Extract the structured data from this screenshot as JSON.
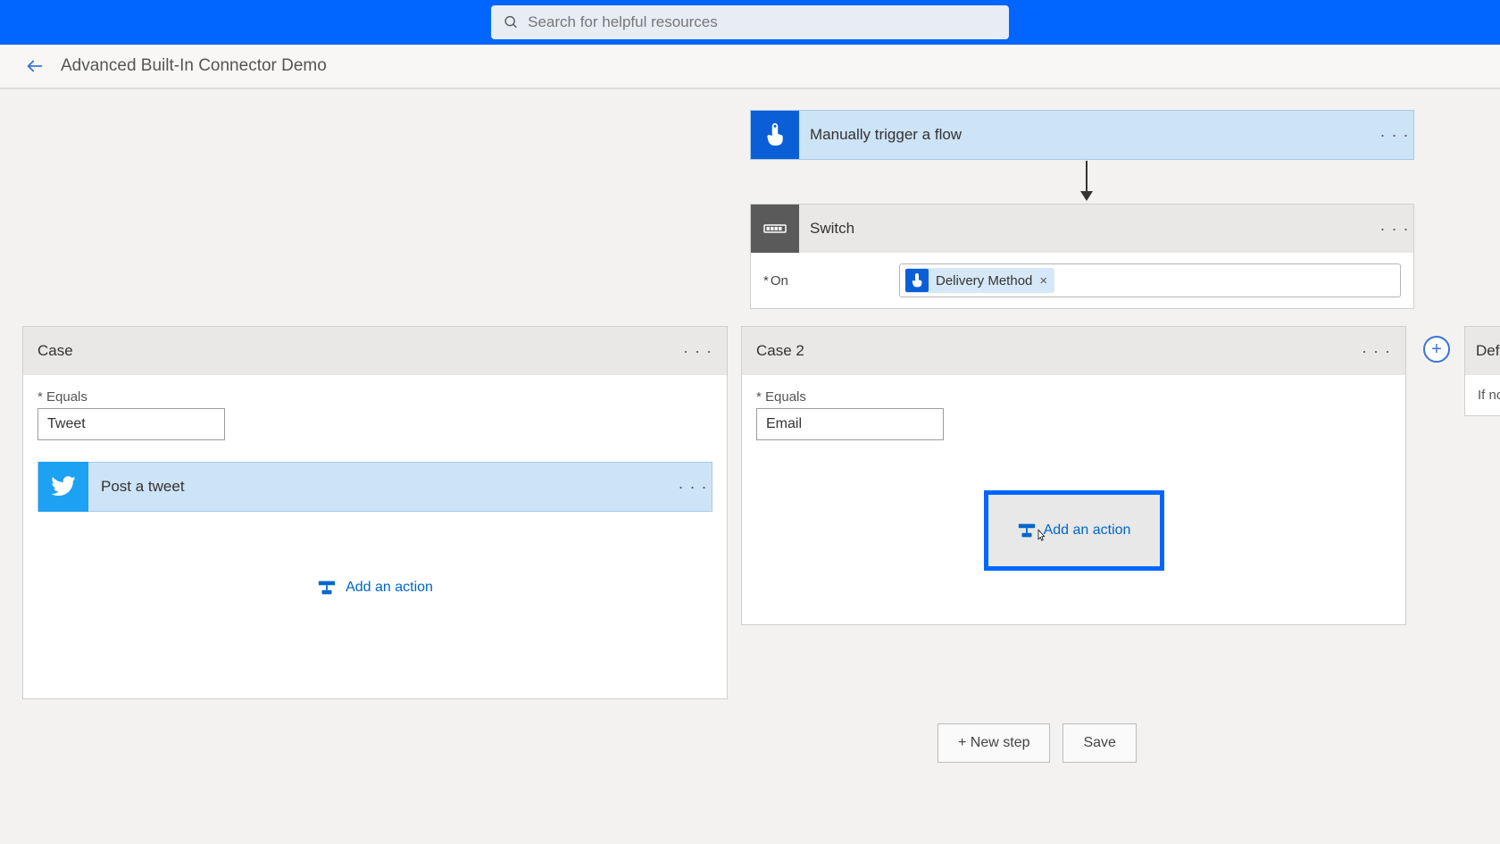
{
  "search": {
    "placeholder": "Search for helpful resources"
  },
  "page": {
    "title": "Advanced Built-In Connector Demo"
  },
  "trigger": {
    "label": "Manually trigger a flow"
  },
  "switch": {
    "label": "Switch",
    "on_label": "On",
    "token": "Delivery Method",
    "token_close": "×"
  },
  "case1": {
    "title": "Case",
    "equals_label": "Equals",
    "equals_value": "Tweet",
    "action_label": "Post a tweet",
    "add_action": "Add an action"
  },
  "case2": {
    "title": "Case 2",
    "equals_label": "Equals",
    "equals_value": "Email",
    "add_action": "Add an action"
  },
  "default_card": {
    "title": "Defa",
    "body": "If no"
  },
  "footer": {
    "new_step": "+ New step",
    "save": "Save"
  },
  "menu_glyph": "· · ·",
  "plus_glyph": "+"
}
